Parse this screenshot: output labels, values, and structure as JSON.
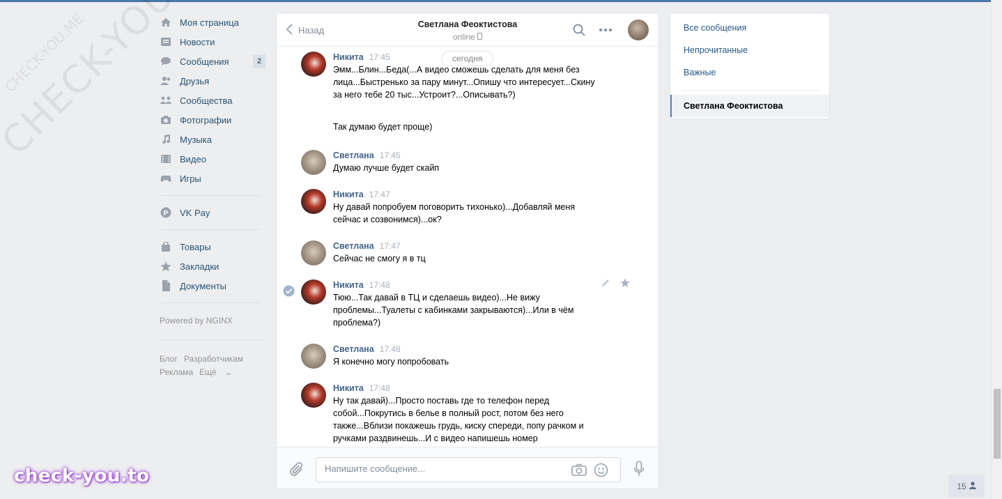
{
  "watermark": {
    "large": "CHECK-YOU.ME",
    "small": "CHECK-YOU.ME"
  },
  "nav": {
    "items": [
      {
        "label": "Моя страница",
        "icon": "home-icon"
      },
      {
        "label": "Новости",
        "icon": "news-icon"
      },
      {
        "label": "Сообщения",
        "icon": "messages-icon",
        "badge": "2"
      },
      {
        "label": "Друзья",
        "icon": "friends-icon"
      },
      {
        "label": "Сообщества",
        "icon": "groups-icon"
      },
      {
        "label": "Фотографии",
        "icon": "camera-icon"
      },
      {
        "label": "Музыка",
        "icon": "music-icon"
      },
      {
        "label": "Видео",
        "icon": "video-icon"
      },
      {
        "label": "Игры",
        "icon": "gamepad-icon"
      }
    ],
    "vkpay": {
      "label": "VK Pay",
      "icon": "vkpay-icon"
    },
    "extra": [
      {
        "label": "Товары",
        "icon": "bag-icon"
      },
      {
        "label": "Закладки",
        "icon": "star-icon"
      },
      {
        "label": "Документы",
        "icon": "document-icon"
      }
    ],
    "powered": "Powered by NGINX",
    "footer": {
      "blog": "Блог",
      "dev": "Разработчикам",
      "ads": "Реклама",
      "more": "Ещё"
    }
  },
  "chat": {
    "back_label": "Назад",
    "title": "Светлана Феоктистова",
    "status": "online",
    "date_divider": "сегодня",
    "messages": [
      {
        "author": "Никита",
        "time": "17:45",
        "text": "Эмм...Блин...Беда(...А видео сможешь сделать для меня без лица...Быстренько за пару минут...Опишу что интересует...Скину за него тебе 20 тыс...Устроит?...Описывать?)",
        "text2": "Так думаю будет проще)"
      },
      {
        "author": "Светлана",
        "time": "17:45",
        "text": "Думаю лучше будет скайп"
      },
      {
        "author": "Никита",
        "time": "17:47",
        "text": "Ну давай попробуем поговорить тихонько)...Добавляй меня сейчас и созвонимся)...ок?"
      },
      {
        "author": "Светлана",
        "time": "17:47",
        "text": "Сейчас не смогу я в тц"
      },
      {
        "author": "Никита",
        "time": "17:48",
        "text": "Тюю...Так давай в ТЦ и сделаешь видео)...Не вижу проблемы...Туалеты с кабинками закрываются)...Или в чём проблема?)"
      },
      {
        "author": "Светлана",
        "time": "17:48",
        "text": "Я конечно могу попробовать"
      },
      {
        "author": "Никита",
        "time": "17:48",
        "text": "Ну так давай)...Просто поставь где то телефон перед собой...Покрутись в белье в полный рост, потом без него также...Вблизи покажешь грудь, киску спереди, попу рачком и ручками раздвинешь...И с видео напишешь номер"
      }
    ],
    "composer": {
      "placeholder": "Напишите сообщение..."
    }
  },
  "filters": {
    "items": [
      "Все сообщения",
      "Непрочитанные",
      "Важные"
    ],
    "active": "Светлана Феоктистова"
  },
  "online_count": "15",
  "site_logo": "check-you.to",
  "colors": {
    "accent": "#4a76a8",
    "link": "#2a5885",
    "author": "#42648b",
    "background": "#edeef0"
  }
}
